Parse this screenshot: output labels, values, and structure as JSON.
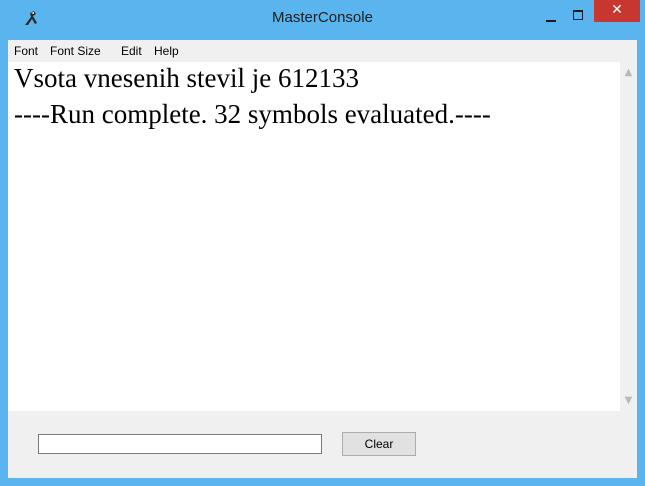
{
  "window": {
    "title": "MasterConsole",
    "icon": "masterconsole-app-icon",
    "controls": {
      "minimize_icon": "minimize-icon",
      "maximize_icon": "maximize-icon",
      "close_label": "✕"
    },
    "colors": {
      "titlebar": "#5ab4ee",
      "close_button": "#c7372f"
    }
  },
  "menubar": {
    "items": [
      "Font",
      "Font Size",
      "Edit",
      "Help"
    ]
  },
  "console": {
    "lines": [
      "Vsota vnesenih stevil je 612133",
      "----Run complete.  32 symbols evaluated.----"
    ]
  },
  "scrollbar": {
    "up_icon": "▲",
    "down_icon": "▼"
  },
  "input": {
    "value": "",
    "placeholder": ""
  },
  "buttons": {
    "clear_label": "Clear"
  }
}
